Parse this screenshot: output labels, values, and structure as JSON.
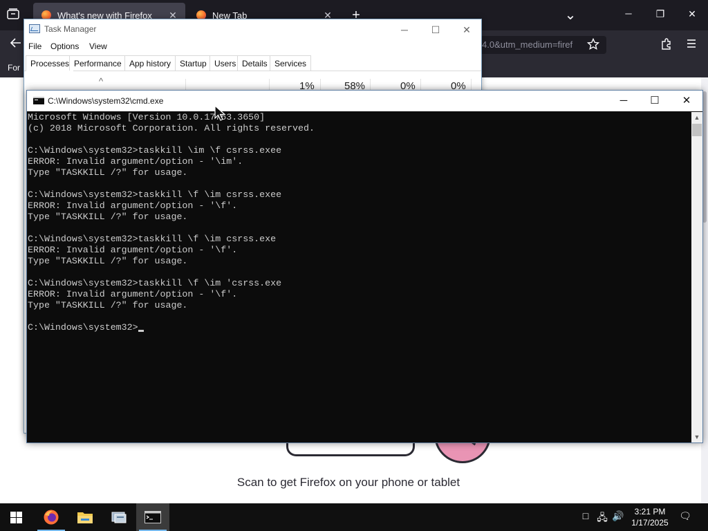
{
  "firefox": {
    "tabs": [
      {
        "label": "What's new with Firefox",
        "close": "✕"
      },
      {
        "label": "New Tab",
        "close": "✕"
      }
    ],
    "new_tab_glyph": "+",
    "list_tabs_glyph": "⌄",
    "window_controls": {
      "minimize": "─",
      "restore": "❐",
      "close": "✕"
    },
    "url_tail": "4.0&utm_medium=firef",
    "bookmark_label": "For",
    "page_text": "Scan to get Firefox on your phone or tablet",
    "icons": [
      "tab-manager-icon",
      "back-arrow-icon",
      "bookmark-star-icon",
      "extensions-icon",
      "menu-icon",
      "firefox-favicon"
    ]
  },
  "task_manager": {
    "title": "Task Manager",
    "menu": [
      "File",
      "Options",
      "View"
    ],
    "tabs": [
      "Processes",
      "Performance",
      "App history",
      "Startup",
      "Users",
      "Details",
      "Services"
    ],
    "active_tab": "Processes",
    "header": {
      "sort_arrow": "^",
      "cpu": "1%",
      "memory": "58%",
      "disk": "0%",
      "network": "0%"
    },
    "window_controls": {
      "minimize": "─",
      "maximize": "☐",
      "close": "✕"
    }
  },
  "cmd": {
    "title": "C:\\Windows\\system32\\cmd.exe",
    "window_controls": {
      "minimize": "─",
      "maximize": "☐",
      "close": "✕"
    },
    "lines": [
      "Microsoft Windows [Version 10.0.17763.3650]",
      "(c) 2018 Microsoft Corporation. All rights reserved.",
      "",
      "C:\\Windows\\system32>taskkill \\im \\f csrss.exee",
      "ERROR: Invalid argument/option - '\\im'.",
      "Type \"TASKKILL /?\" for usage.",
      "",
      "C:\\Windows\\system32>taskkill \\f \\im csrss.exee",
      "ERROR: Invalid argument/option - '\\f'.",
      "Type \"TASKKILL /?\" for usage.",
      "",
      "C:\\Windows\\system32>taskkill \\f \\im csrss.exe",
      "ERROR: Invalid argument/option - '\\f'.",
      "Type \"TASKKILL /?\" for usage.",
      "",
      "C:\\Windows\\system32>taskkill \\f \\im 'csrss.exe",
      "ERROR: Invalid argument/option - '\\f'.",
      "Type \"TASKKILL /?\" for usage.",
      ""
    ],
    "prompt": "C:\\Windows\\system32>",
    "scroll_up": "▲",
    "scroll_down": "▼"
  },
  "taskbar": {
    "apps": [
      "start-button",
      "firefox",
      "file-explorer",
      "server-manager",
      "command-prompt"
    ],
    "tray": {
      "volume": "🔊",
      "network": "🖧",
      "notification_area": "□",
      "action_center": "🗨"
    },
    "clock": {
      "time": "3:21 PM",
      "date": "1/17/2025"
    }
  },
  "colors": {
    "firefox_chrome": "#1c1b22",
    "firefox_toolbar": "#2b2a33",
    "cmd_background": "#0c0c0c",
    "cmd_text": "#cccccc",
    "taskbar": "#101010",
    "taskbar_running_indicator": "#76b9ed"
  }
}
